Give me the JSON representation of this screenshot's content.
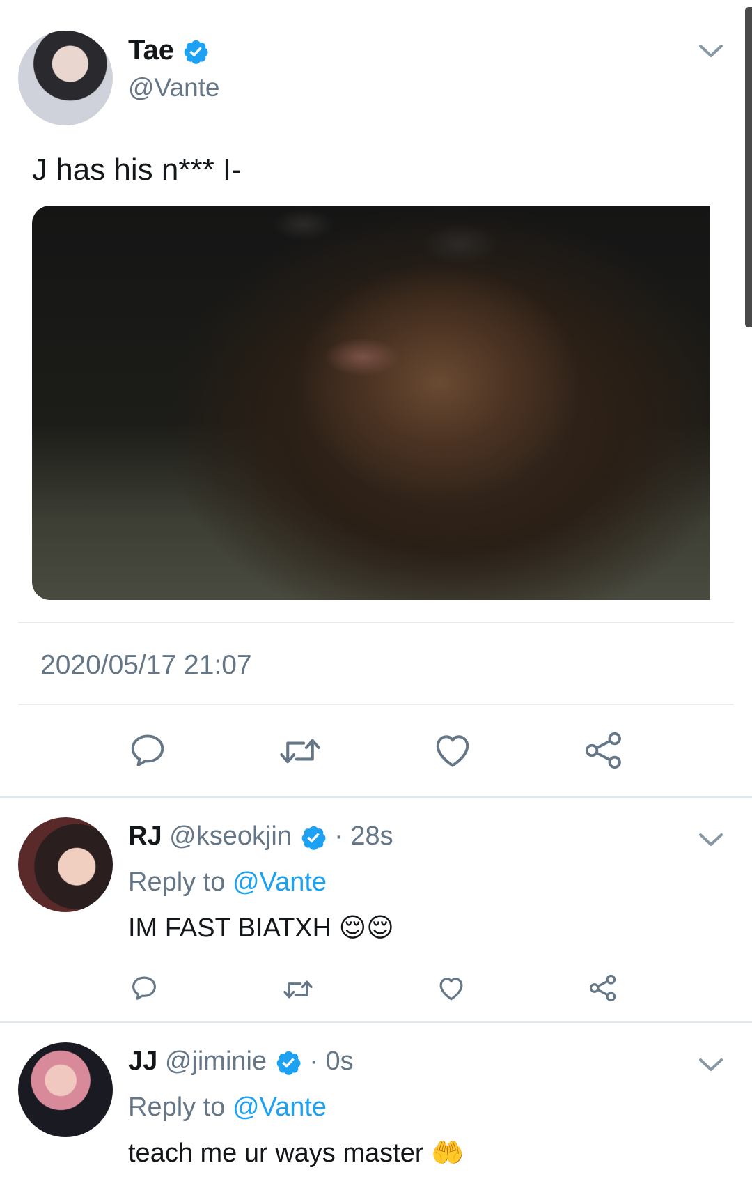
{
  "main_tweet": {
    "display_name": "Tae",
    "handle": "@Vante",
    "text": "J has his n*** I-",
    "timestamp": "2020/05/17 21:07"
  },
  "replies": [
    {
      "display_name": "RJ",
      "handle": "@kseokjin",
      "age": "· 28s",
      "reply_prefix": "Reply to",
      "reply_to": "@Vante",
      "text": "IM FAST BIATXH 😌😌"
    },
    {
      "display_name": "JJ",
      "handle": "@jiminie",
      "age": "· 0s",
      "reply_prefix": "Reply to",
      "reply_to": "@Vante",
      "text": "teach me ur ways master 🤲"
    }
  ],
  "icons": {
    "reply": "reply-icon",
    "retweet": "retweet-icon",
    "like": "heart-icon",
    "share": "share-icon",
    "more": "chevron-down-icon",
    "verified": "verified-badge-icon"
  },
  "colors": {
    "accent": "#1da1f2",
    "muted": "#657786",
    "icon": "#657786"
  }
}
